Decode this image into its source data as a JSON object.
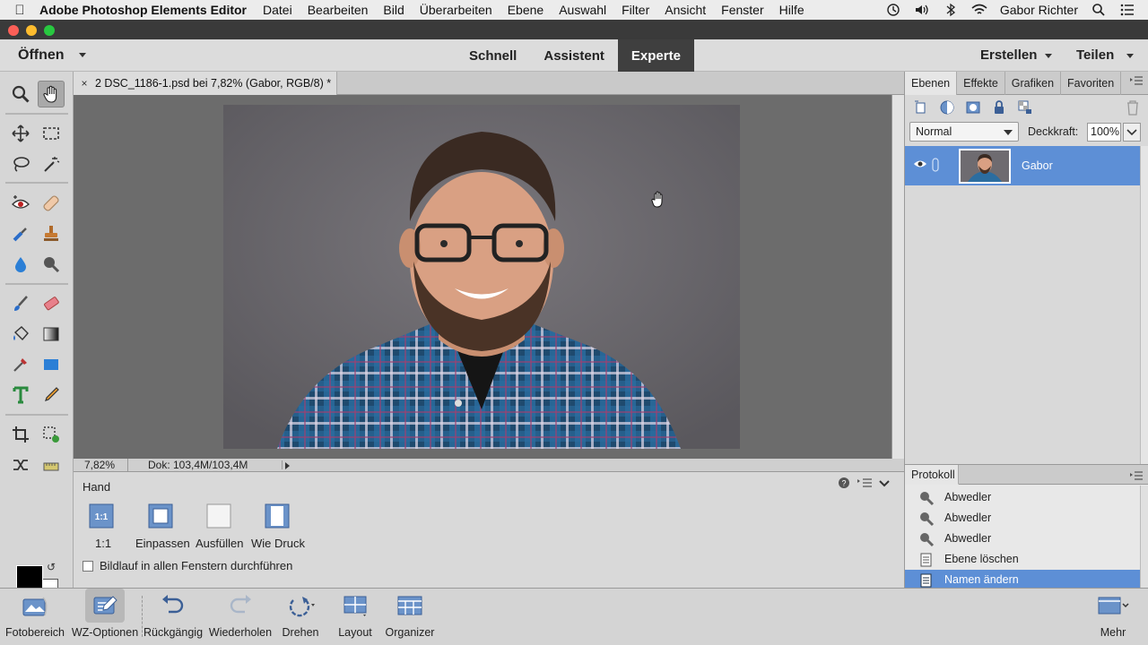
{
  "menubar": {
    "app_name": "Adobe Photoshop Elements Editor",
    "items": [
      "Datei",
      "Bearbeiten",
      "Bild",
      "Überarbeiten",
      "Ebene",
      "Auswahl",
      "Filter",
      "Ansicht",
      "Fenster",
      "Hilfe"
    ],
    "user": "Gabor Richter"
  },
  "topbar": {
    "open_label": "Öffnen",
    "modes": [
      "Schnell",
      "Assistent",
      "Experte"
    ],
    "active_mode": "Experte",
    "create_label": "Erstellen",
    "share_label": "Teilen"
  },
  "document": {
    "tab_title": "2 DSC_1186-1.psd bei 7,82% (Gabor, RGB/8) *",
    "close_glyph": "×",
    "zoom": "7,82%",
    "doc_size": "Dok: 103,4M/103,4M"
  },
  "tool_options": {
    "title": "Hand",
    "buttons": [
      {
        "label": "1:1",
        "icon_text": "1:1"
      },
      {
        "label": "Einpassen",
        "icon_text": ""
      },
      {
        "label": "Ausfüllen",
        "icon_text": ""
      },
      {
        "label": "Wie Druck",
        "icon_text": ""
      }
    ],
    "checkbox_label": "Bildlauf in allen Fenstern durchführen",
    "checkbox_checked": false
  },
  "layers_panel": {
    "tabs": [
      "Ebenen",
      "Effekte",
      "Grafiken",
      "Favoriten"
    ],
    "active_tab": "Ebenen",
    "blend_mode": "Normal",
    "opacity_label": "Deckkraft:",
    "opacity_value": "100%",
    "layers": [
      {
        "name": "Gabor",
        "visible": true
      }
    ]
  },
  "history_panel": {
    "tab": "Protokoll",
    "items": [
      {
        "label": "Abwedler",
        "icon": "dodge-icon"
      },
      {
        "label": "Abwedler",
        "icon": "dodge-icon"
      },
      {
        "label": "Abwedler",
        "icon": "dodge-icon"
      },
      {
        "label": "Ebene löschen",
        "icon": "layer-action-icon"
      },
      {
        "label": "Namen ändern",
        "icon": "layer-action-icon",
        "selected": true
      }
    ]
  },
  "bottombar": {
    "items": [
      "Fotobereich",
      "WZ-Optionen",
      "Rückgängig",
      "Wiederholen",
      "Drehen",
      "Layout",
      "Organizer"
    ],
    "more_label": "Mehr"
  },
  "colors": {
    "accent": "#5d8fd6",
    "foreground": "#000000",
    "background": "#ffffff"
  }
}
